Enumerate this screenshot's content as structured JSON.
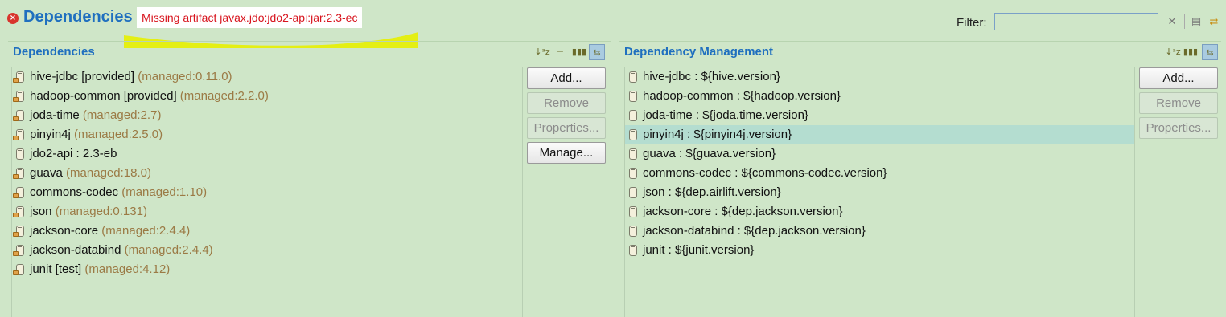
{
  "header": {
    "title": "Dependencies",
    "error_message": "Missing artifact javax.jdo:jdo2-api:jar:2.3-ec",
    "filter_label": "Filter:",
    "filter_value": ""
  },
  "dependencies": {
    "title": "Dependencies",
    "items": [
      {
        "name": "hive-jdbc [provided]",
        "managed": "(managed:0.11.0)",
        "locked": true
      },
      {
        "name": "hadoop-common [provided]",
        "managed": "(managed:2.2.0)",
        "locked": true
      },
      {
        "name": "joda-time",
        "managed": "(managed:2.7)",
        "locked": true
      },
      {
        "name": "pinyin4j",
        "managed": "(managed:2.5.0)",
        "locked": true
      },
      {
        "name": "jdo2-api : 2.3-eb",
        "managed": "",
        "locked": false
      },
      {
        "name": "guava",
        "managed": "(managed:18.0)",
        "locked": true
      },
      {
        "name": "commons-codec",
        "managed": "(managed:1.10)",
        "locked": true
      },
      {
        "name": "json",
        "managed": "(managed:0.131)",
        "locked": true
      },
      {
        "name": "jackson-core",
        "managed": "(managed:2.4.4)",
        "locked": true
      },
      {
        "name": "jackson-databind",
        "managed": "(managed:2.4.4)",
        "locked": true
      },
      {
        "name": "junit [test]",
        "managed": "(managed:4.12)",
        "locked": true
      }
    ],
    "buttons": {
      "add": "Add...",
      "remove": "Remove",
      "properties": "Properties...",
      "manage": "Manage..."
    }
  },
  "management": {
    "title": "Dependency Management",
    "selected_index": 3,
    "items": [
      "hive-jdbc : ${hive.version}",
      "hadoop-common : ${hadoop.version}",
      "joda-time : ${joda.time.version}",
      "pinyin4j : ${pinyin4j.version}",
      "guava : ${guava.version}",
      "commons-codec : ${commons-codec.version}",
      "json : ${dep.airlift.version}",
      "jackson-core : ${dep.jackson.version}",
      "jackson-databind : ${dep.jackson.version}",
      "junit : ${junit.version}"
    ],
    "buttons": {
      "add": "Add...",
      "remove": "Remove",
      "properties": "Properties..."
    }
  },
  "colors": {
    "background": "#cfe6c8",
    "title_blue": "#1f6fbf",
    "error_red": "#d8141e",
    "managed_text": "#9b7a45",
    "selection": "#b4ddd0",
    "highlight_yellow": "#e6f000"
  },
  "icons": [
    "error-icon",
    "jar-icon",
    "lock-icon",
    "sort-az-icon",
    "hierarchy-icon",
    "columns-icon",
    "filter-icon",
    "clear-icon",
    "sync-icon",
    "expand-icon"
  ]
}
